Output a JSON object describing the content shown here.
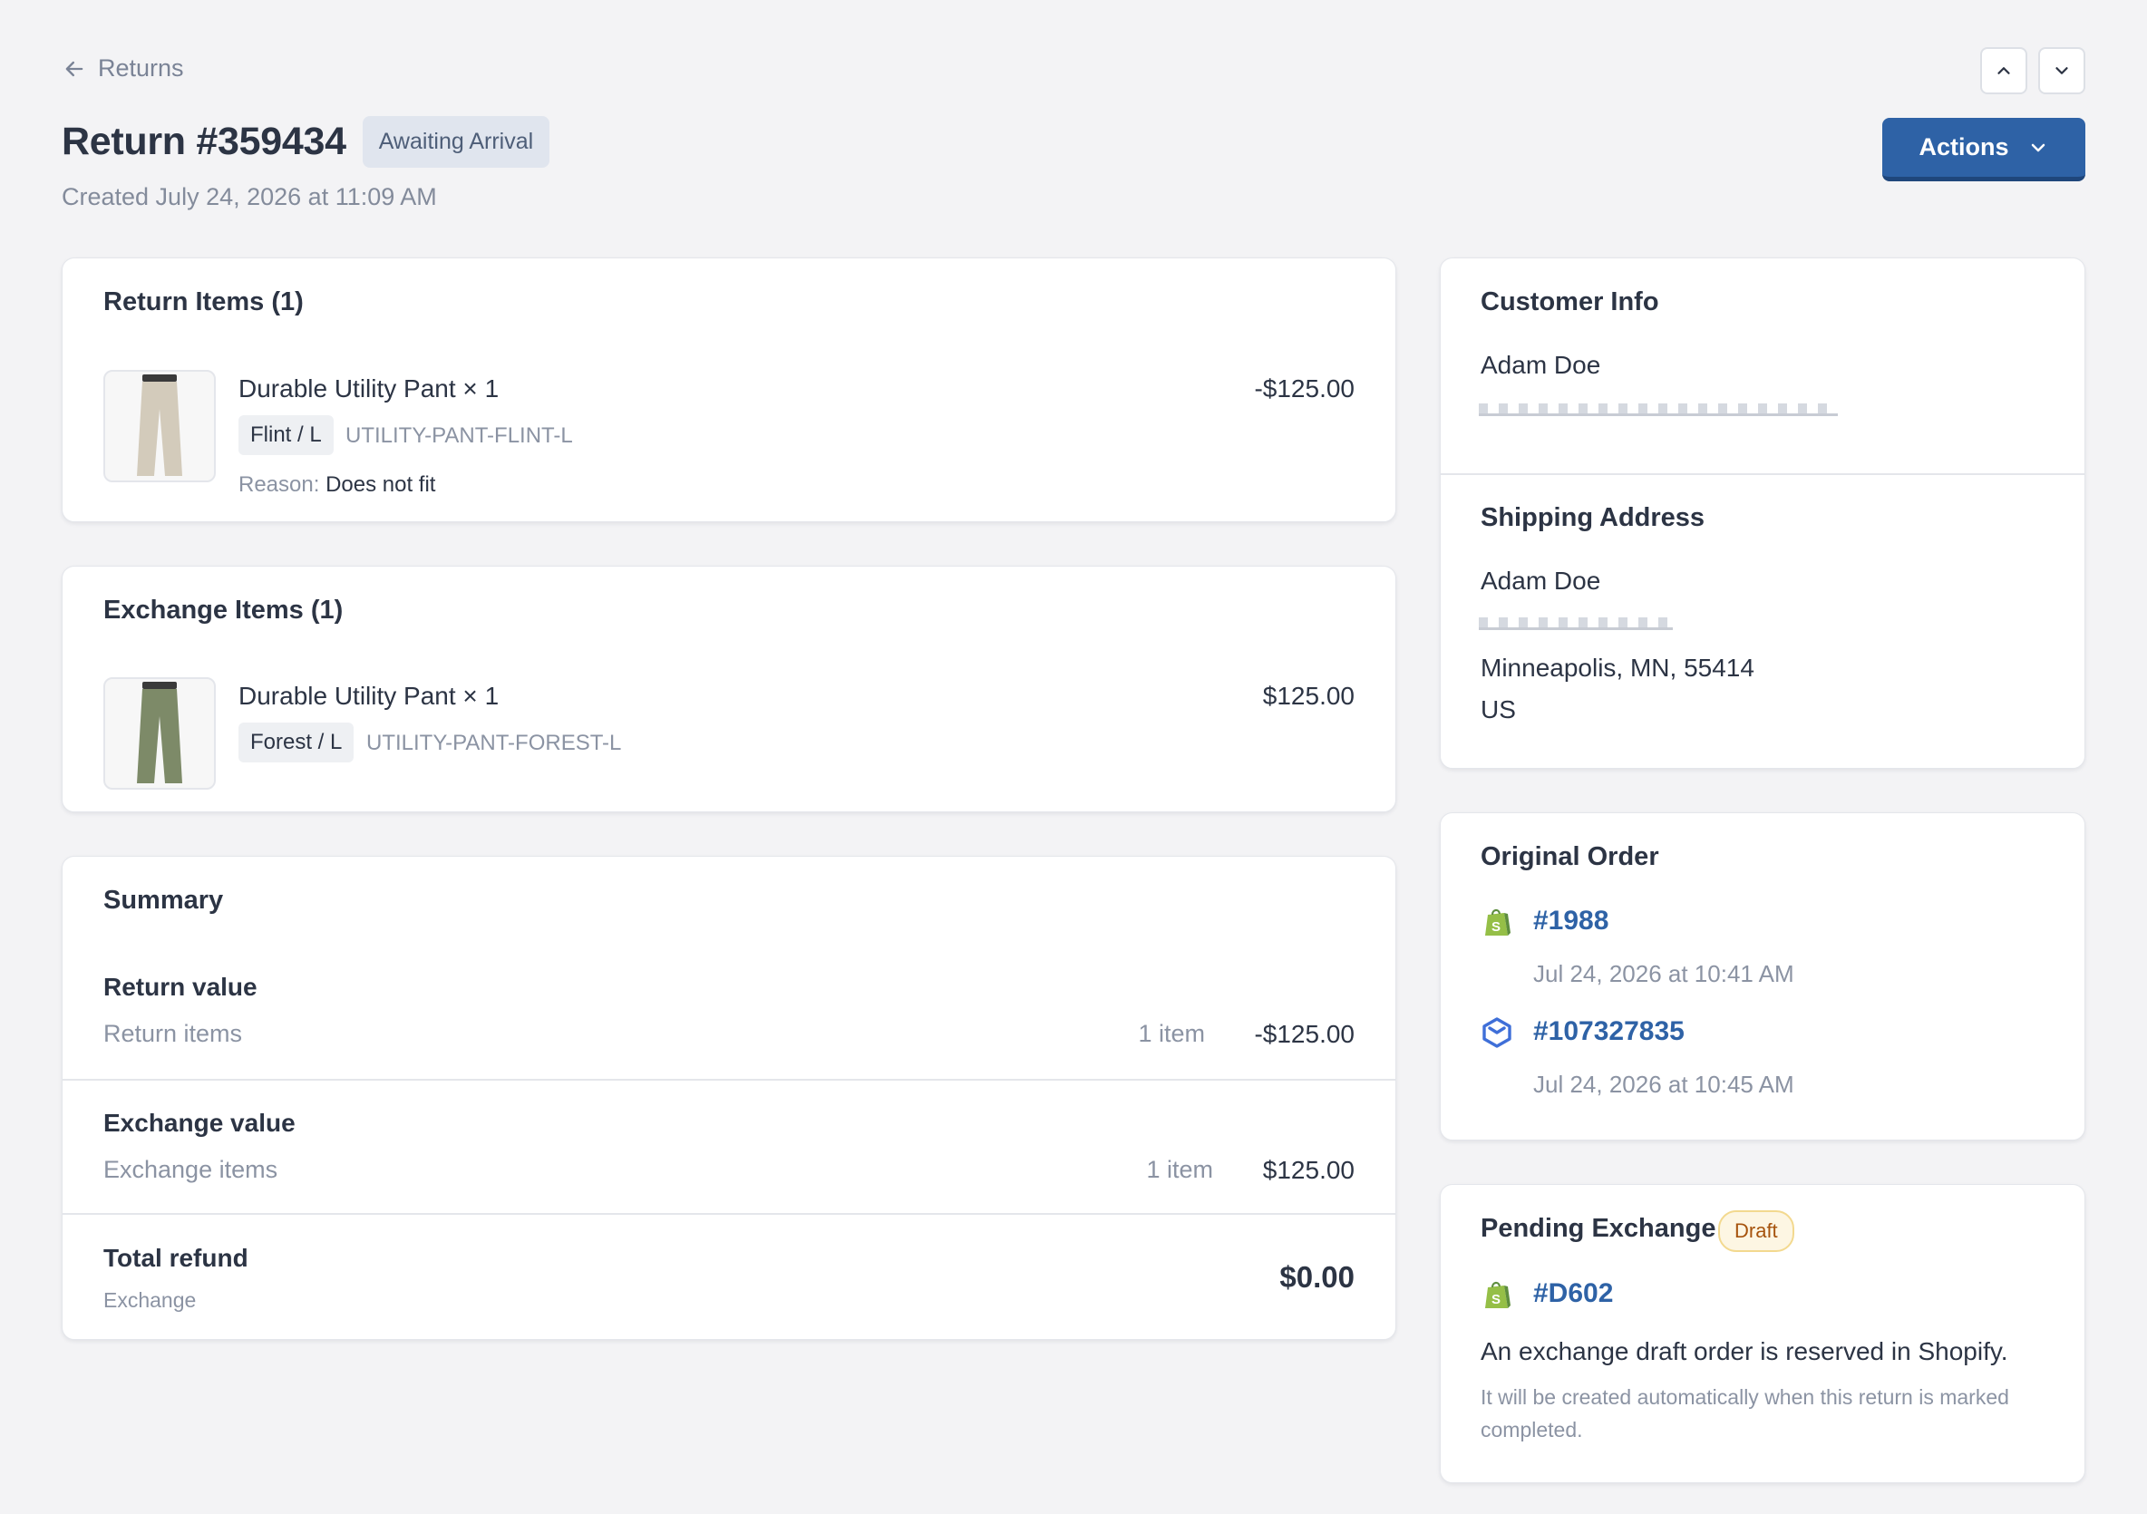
{
  "header": {
    "back_label": "Returns",
    "title": "Return #359434",
    "status": "Awaiting Arrival",
    "created": "Created July 24, 2026 at 11:09 AM",
    "actions_label": "Actions"
  },
  "return_items": {
    "title": "Return Items (1)",
    "item": {
      "name": "Durable Utility Pant × 1",
      "variant": "Flint / L",
      "sku": "UTILITY-PANT-FLINT-L",
      "price": "-$125.00",
      "reason_label": "Reason:",
      "reason_value": "Does not fit",
      "color": "#d3cbbb"
    }
  },
  "exchange_items": {
    "title": "Exchange Items (1)",
    "item": {
      "name": "Durable Utility Pant × 1",
      "variant": "Forest / L",
      "sku": "UTILITY-PANT-FOREST-L",
      "price": "$125.00",
      "color": "#7d8a68"
    }
  },
  "summary": {
    "title": "Summary",
    "return_value": {
      "heading": "Return value",
      "label": "Return items",
      "count": "1 item",
      "amount": "-$125.00"
    },
    "exchange_value": {
      "heading": "Exchange value",
      "label": "Exchange items",
      "count": "1 item",
      "amount": "$125.00"
    },
    "total": {
      "heading": "Total refund",
      "sub": "Exchange",
      "amount": "$0.00"
    }
  },
  "customer": {
    "title": "Customer Info",
    "name": "Adam Doe"
  },
  "shipping": {
    "title": "Shipping Address",
    "name": "Adam Doe",
    "city_line": "Minneapolis, MN, 55414",
    "country": "US"
  },
  "original_order": {
    "title": "Original Order",
    "orders": [
      {
        "number": "#1988",
        "date": "Jul 24, 2026 at 10:41 AM",
        "icon": "shopify-icon"
      },
      {
        "number": "#107327835",
        "date": "Jul 24, 2026 at 10:45 AM",
        "icon": "shipbob-icon"
      }
    ]
  },
  "pending_exchange": {
    "title": "Pending Exchange",
    "badge": "Draft",
    "order_number": "#D602",
    "message": "An exchange draft order is reserved in Shopify.",
    "note": "It will be created automatically when this return is marked completed."
  },
  "colors": {
    "accent": "#2e62a6",
    "shopify_green": "#95bf47",
    "shipbob_blue": "#3f6fd8"
  }
}
